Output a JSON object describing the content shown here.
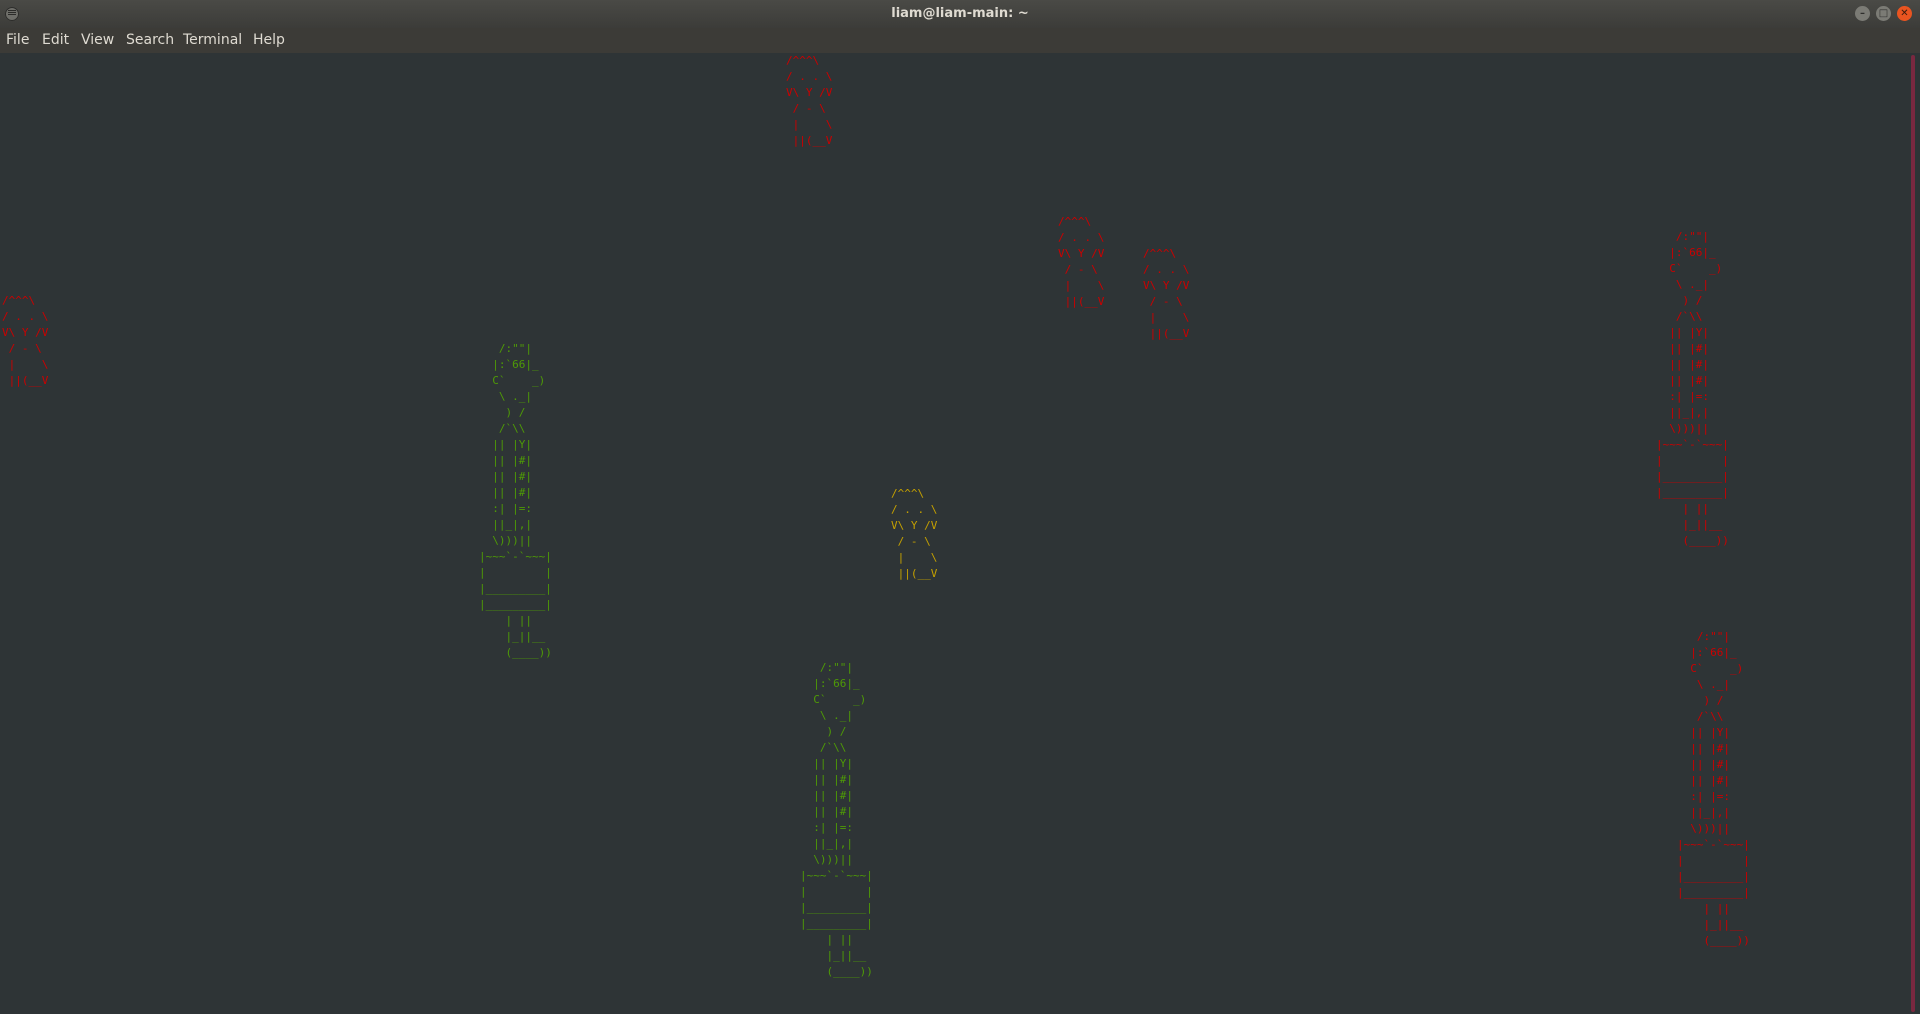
{
  "window": {
    "title": "liam@liam-main: ~"
  },
  "menu": [
    "File",
    "Edit",
    "View",
    "Search",
    "Terminal",
    "Help"
  ],
  "window_controls": {
    "minimize": "–",
    "maximize": "□",
    "close": "✕"
  },
  "colors": {
    "red": "#cc0000",
    "green": "#4e9a06",
    "yellow": "#c4a000",
    "background": "#2e3436"
  },
  "art": {
    "cat_red_1": "/^^^\\\n/ . . \\\nV\\ Y /V\n / - \\\n |    \\\n ||(__V",
    "cat_red_2": "/^^^\\\n/ . . \\\nV\\ Y /V\n / - \\\n |    \\\n ||(__V",
    "cat_red_3": "/^^^\\\n/ . . \\\nV\\ Y /V\n / - \\\n |    \\\n ||(__V",
    "cat_red_4": "/^^^\\\n/ . . \\\nV\\ Y /V\n / - \\\n |    \\\n ||(__V",
    "cat_yellow": "/^^^\\\n/ . . \\\nV\\ Y /V\n / - \\\n |    \\\n ||(__V",
    "person_green_1": "   /:\"\"|\n  |:`66|_\n  C`    _)\n   \\ ._|\n    ) /\n   /`\\\\\n  || |Y|\n  || |#|\n  || |#|\n  || |#|\n  :| |=:\n  ||_|,|\n  \\)))||\n|~~~`-`~~~|\n|         |\n|_________|\n|_________|\n    | ||\n    |_||__\n    (____))",
    "person_green_2": "   /:\"\"|\n  |:`66|_\n  C`    _)\n   \\ ._|\n    ) /\n   /`\\\\\n  || |Y|\n  || |#|\n  || |#|\n  || |#|\n  :| |=:\n  ||_|,|\n  \\)))||\n|~~~`-`~~~|\n|         |\n|_________|\n|_________|\n    | ||\n    |_||__\n    (____))",
    "person_red_1": "   /:\"\"|\n  |:`66|_\n  C`    _)\n   \\ ._|\n    ) /\n   /`\\\\\n  || |Y|\n  || |#|\n  || |#|\n  || |#|\n  :| |=:\n  ||_|,|\n  \\)))||\n|~~~`-`~~~|\n|         |\n|_________|\n|_________|\n    | ||\n    |_||__\n    (____))",
    "person_red_2": "   /:\"\"|\n  |:`66|_\n  C`    _)\n   \\ ._|\n    ) /\n   /`\\\\\n  || |Y|\n  || |#|\n  || |#|\n  || |#|\n  :| |=:\n  ||_|,|\n  \\)))||\n|~~~`-`~~~|\n|         |\n|_________|\n|_________|\n    | ||\n    |_||__\n    (____))"
  }
}
